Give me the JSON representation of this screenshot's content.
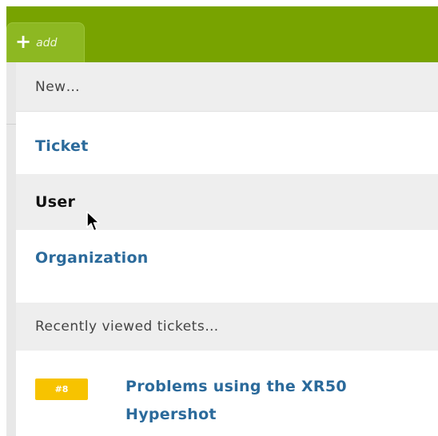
{
  "toolbar": {
    "add_icon": "plus-icon",
    "add_label": "add"
  },
  "menu": {
    "new_header": "New…",
    "items": [
      {
        "label": "Ticket"
      },
      {
        "label": "User"
      },
      {
        "label": "Organization"
      }
    ],
    "recent_header": "Recently viewed tickets…",
    "recent_tickets": [
      {
        "id": "#8",
        "title": "Problems using the XR50 Hypershot"
      }
    ]
  },
  "colors": {
    "header_green": "#78a300",
    "tab_green": "#8db822",
    "link_blue": "#2b6a9b",
    "badge_yellow": "#f7c300",
    "hover_gray": "#eeeeee"
  }
}
